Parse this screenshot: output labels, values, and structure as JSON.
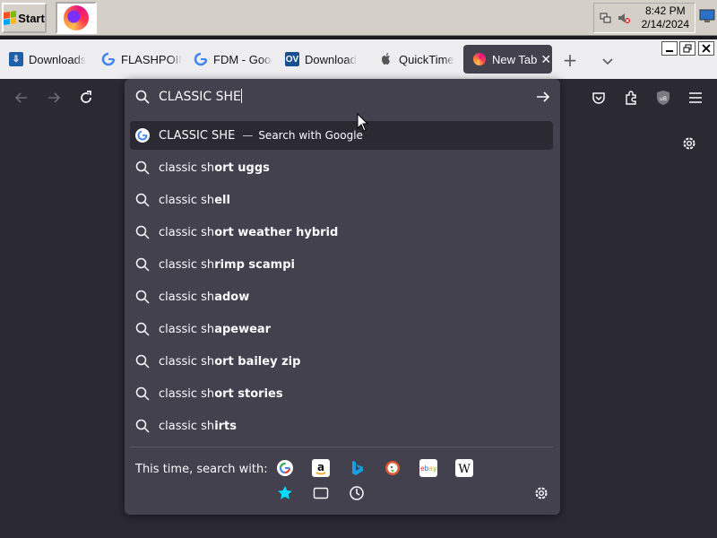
{
  "taskbar": {
    "start_label": "Start",
    "app_icon": "firefox-icon",
    "clock_time": "8:42 PM",
    "clock_date": "2/14/2024"
  },
  "tabs": [
    {
      "label": "Downloads",
      "icon": "downloads-site-icon"
    },
    {
      "label": "FLASHPOINT",
      "icon": "google-g-icon"
    },
    {
      "label": "FDM - Google",
      "icon": "google-g-icon"
    },
    {
      "label": "Download",
      "icon": "ov-icon",
      "icon_text": "OV"
    },
    {
      "label": "QuickTime",
      "icon": "apple-icon"
    },
    {
      "label": "New Tab",
      "icon": "firefox-icon"
    }
  ],
  "urlbar": {
    "typed_value": "CLASSIC SHE",
    "top_suggestion": {
      "text": "CLASSIC SHE",
      "action": "Search with Google"
    },
    "suggestions": [
      {
        "prefix": "classic sh",
        "bold": "ort uggs"
      },
      {
        "prefix": "classic sh",
        "bold": "ell"
      },
      {
        "prefix": "classic sh",
        "bold": "ort weather hybrid"
      },
      {
        "prefix": "classic sh",
        "bold": "rimp scampi"
      },
      {
        "prefix": "classic sh",
        "bold": "adow"
      },
      {
        "prefix": "classic sh",
        "bold": "apewear"
      },
      {
        "prefix": "classic sh",
        "bold": "ort bailey zip"
      },
      {
        "prefix": "classic sh",
        "bold": "ort stories"
      },
      {
        "prefix": "classic sh",
        "bold": "irts"
      }
    ],
    "oneoff_label": "This time, search with:",
    "engines": [
      "google-icon",
      "amazon-icon",
      "bing-icon",
      "duckduckgo-icon",
      "ebay-icon",
      "wikipedia-icon"
    ],
    "modes": [
      "bookmarks-star-icon",
      "tabs-icon",
      "history-clock-icon"
    ]
  },
  "colors": {
    "accent": "#42414d",
    "toolbar": "#2b2a33",
    "text": "#fbfbfe"
  }
}
